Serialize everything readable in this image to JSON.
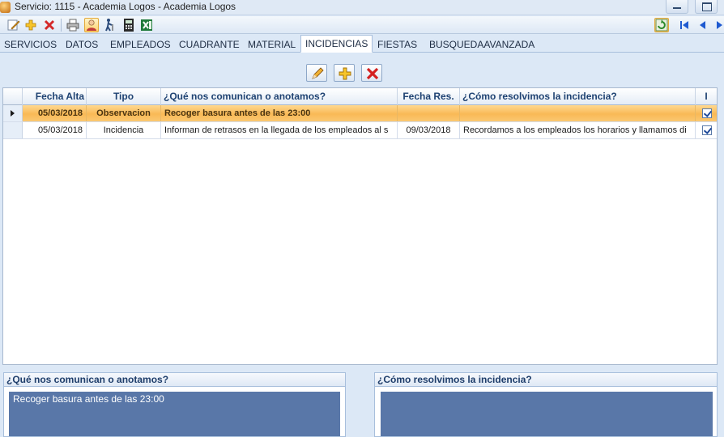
{
  "window": {
    "title": "Servicio: 1115 - Academia Logos - Academia Logos"
  },
  "toolbar": {
    "icons": [
      "edit-icon",
      "add-icon",
      "delete-icon",
      "print-icon",
      "user-icon",
      "walker-icon",
      "calculator-icon",
      "excel-icon",
      "refresh-icon",
      "first-icon",
      "previous-icon",
      "next-icon"
    ]
  },
  "tabs": [
    {
      "label": "SERVICIOS"
    },
    {
      "label": "DATOS"
    },
    {
      "label": "EMPLEADOS"
    },
    {
      "label": "CUADRANTE"
    },
    {
      "label": "MATERIAL"
    },
    {
      "label": "INCIDENCIAS",
      "selected": true
    },
    {
      "label": "FIESTAS"
    },
    {
      "label": "BUSQUEDAAVANZADA"
    }
  ],
  "grid": {
    "columns": [
      "Fecha Alta",
      "Tipo",
      "¿Qué nos comunican o anotamos?",
      "Fecha Res.",
      "¿Cómo resolvimos la incidencia?",
      "I"
    ],
    "rows": [
      {
        "fecha_alta": "05/03/2018",
        "tipo": "Observacion",
        "comunican": "Recoger basura antes de las 23:00",
        "fecha_res": "",
        "resolvimos": "",
        "checked": true,
        "selected": true
      },
      {
        "fecha_alta": "05/03/2018",
        "tipo": "Incidencia",
        "comunican": "Informan de retrasos en la llegada de los empleados al s",
        "fecha_res": "09/03/2018",
        "resolvimos": "Recordamos a los empleados los horarios y llamamos di",
        "checked": true,
        "selected": false
      }
    ]
  },
  "panels": {
    "comunican": {
      "title": "¿Qué nos comunican o anotamos?",
      "text": "Recoger basura antes de las 23:00"
    },
    "resolvimos": {
      "title": "¿Cómo resolvimos la incidencia?",
      "text": ""
    }
  },
  "colors": {
    "selected_row": "#f9b956",
    "panel_body": "#5977a8",
    "header_text": "#1e4272"
  }
}
